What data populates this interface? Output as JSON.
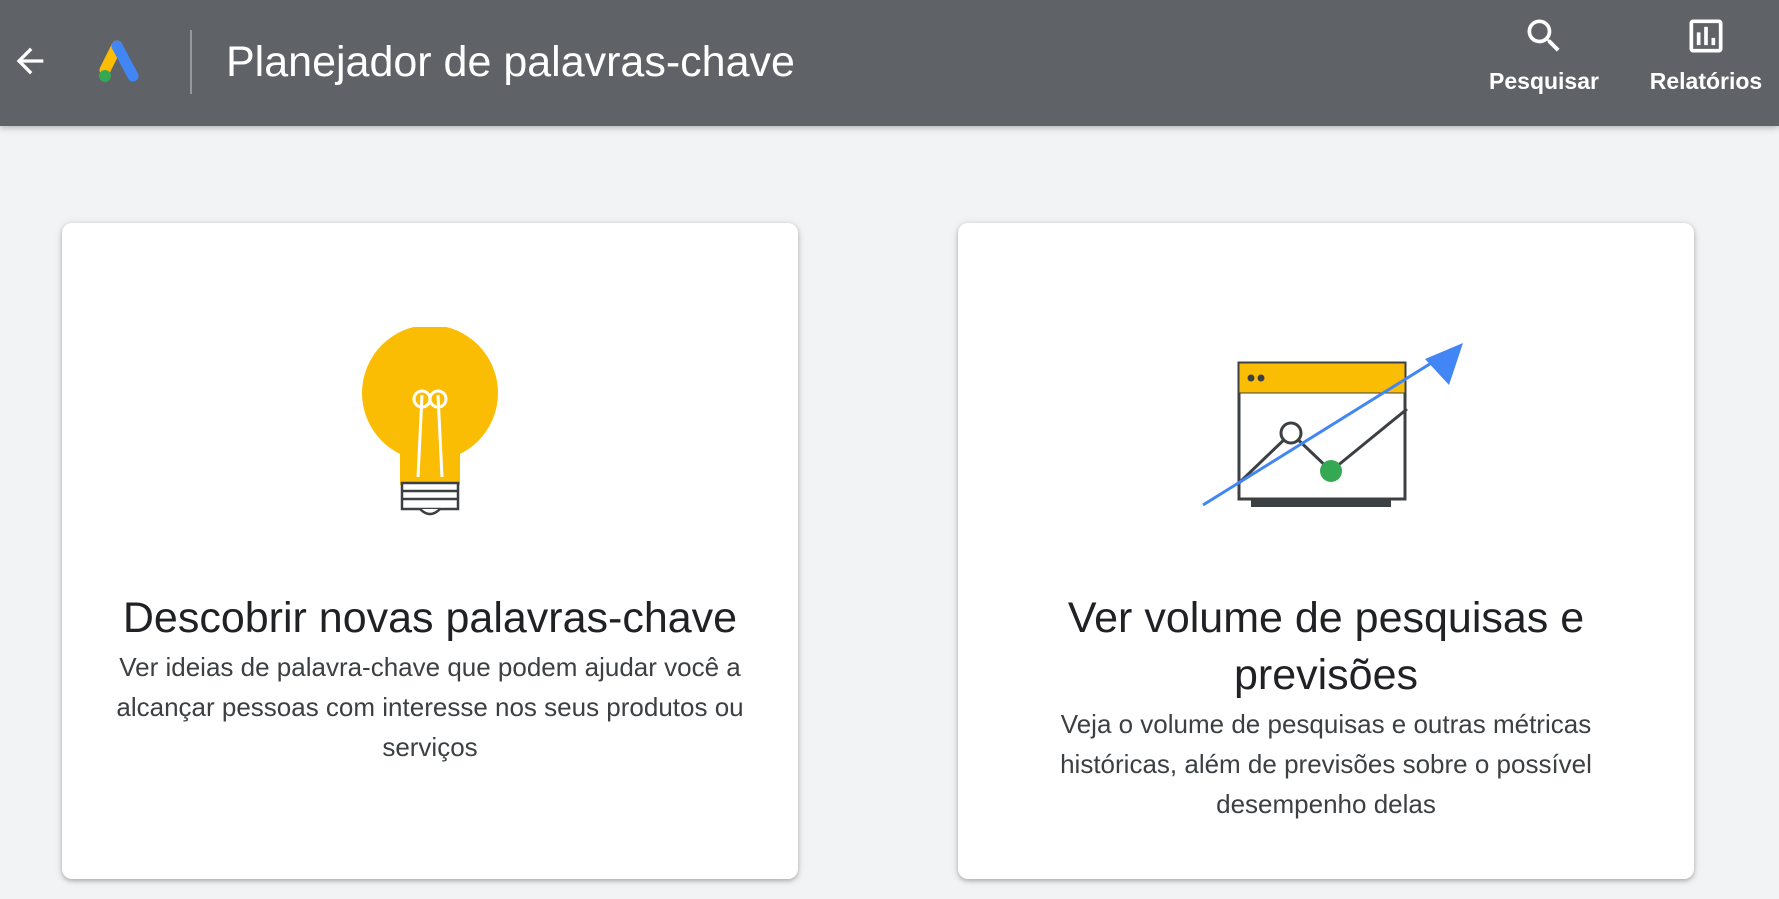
{
  "header": {
    "title": "Planejador de palavras-chave",
    "back_icon": "arrow-back-icon",
    "logo_icon": "google-ads-logo",
    "actions": [
      {
        "label": "Pesquisar",
        "icon": "search-icon"
      },
      {
        "label": "Relatórios",
        "icon": "bar-chart-icon"
      }
    ]
  },
  "cards": [
    {
      "heading": "Descobrir novas palavras-chave",
      "description": "Ver ideias de palavra-chave que podem ajudar você a alcançar pessoas com interesse nos seus produtos ou serviços",
      "illustration": "lightbulb-illustration"
    },
    {
      "heading": "Ver volume de pesquisas e previsões",
      "description": "Veja o volume de pesquisas e outras métricas históricas, além de previsões sobre o possível desempenho delas",
      "illustration": "trend-chart-illustration"
    }
  ],
  "colors": {
    "header_bg": "#5f6368",
    "page_bg": "#f1f3f4",
    "yellow": "#fbbc04",
    "blue": "#4285f4",
    "green": "#34a853"
  }
}
